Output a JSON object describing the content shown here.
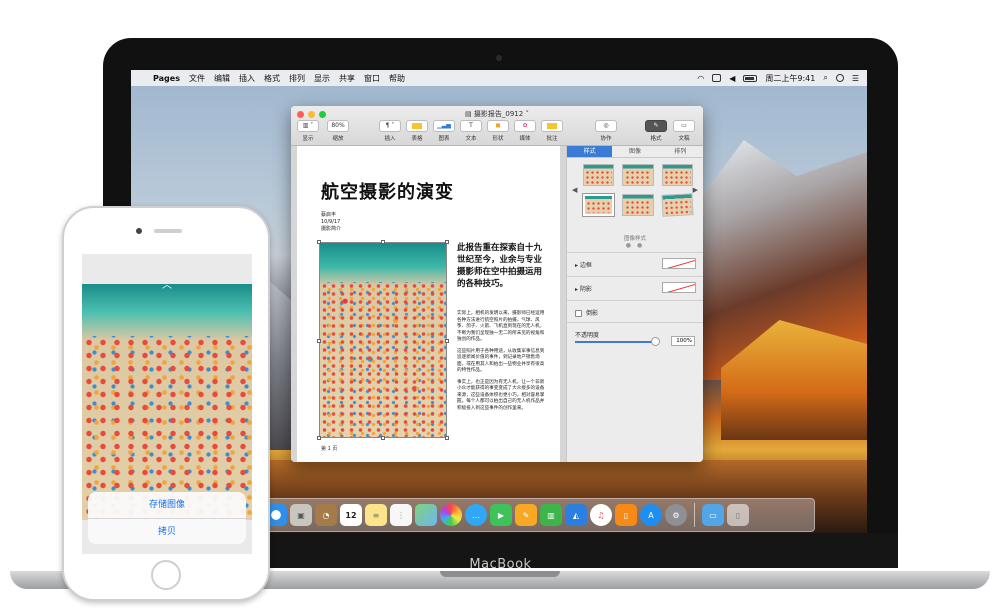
{
  "macbook": {
    "label": "MacBook"
  },
  "menubar": {
    "app": "Pages",
    "items": [
      "文件",
      "编辑",
      "插入",
      "格式",
      "排列",
      "显示",
      "共享",
      "窗口",
      "帮助"
    ],
    "clock": "周二上午9:41"
  },
  "window": {
    "title": "摄影报告_0912",
    "toolbar": {
      "view": "显示",
      "zoom_value": "80%",
      "zoom": "缩放",
      "insert": "插入",
      "table": "表格",
      "chart": "图表",
      "text": "文本",
      "shape": "形状",
      "media": "媒体",
      "comment": "批注",
      "collaborate": "协作",
      "format": "格式",
      "document": "文稿"
    }
  },
  "document": {
    "heading": "航空摄影的演变",
    "meta_lines": [
      "蔡启丰",
      "10/9/17",
      "摄影简介"
    ],
    "lead": "此报告重在探索自十九世纪至今，业余与专业摄影师在空中拍摄运用的各种技巧。",
    "paragraphs": [
      "实际上，相机的发明以来，摄影师已经运用各种方法进行航空照片的拍摄，气球、风筝、鸽子、火箭、飞机直到现在的无人机，不断为我们呈现独一无二的所未见的视角和独创的作品。",
      "这些照片用于各种用途，从收集军事信息到追逐新闻价值的事件，到记录地产销售场面，或在用其人和拍出一些物业并享有很高的特性作品。",
      "事实上，也正是因为有无人机，让一个非新小众才能获得的事变变成了大众接多的设备来源，这些设备体积也更小巧，相对容易掌握。每个人都可以拍出自己的无人机作品并积极投入到这些事件的创作里来。"
    ],
    "page_number": "第 1 页"
  },
  "sidebar": {
    "tabs": [
      "样式",
      "图像",
      "排列"
    ],
    "styles_caption": "图像样式",
    "border": "边框",
    "shadow": "阴影",
    "reflection": "倒影",
    "opacity_label": "不透明度",
    "opacity_value": "100%"
  },
  "iphone": {
    "actions": [
      "存储图像",
      "拷贝"
    ]
  },
  "colors": {
    "accent": "#3a7bd5",
    "ios_action": "#1a6fe8"
  },
  "dock_icons": [
    "safari-icon",
    "photo-browser-icon",
    "contacts-icon",
    "calendar-icon",
    "notes-icon",
    "reminders-icon",
    "maps-icon",
    "photos-icon",
    "messages-icon",
    "facetime-icon",
    "pages-icon",
    "numbers-icon",
    "keynote-icon",
    "music-icon",
    "books-icon",
    "app-store-icon",
    "system-preferences-icon",
    "downloads-folder-icon",
    "trash-icon"
  ],
  "calendar_day": "12"
}
